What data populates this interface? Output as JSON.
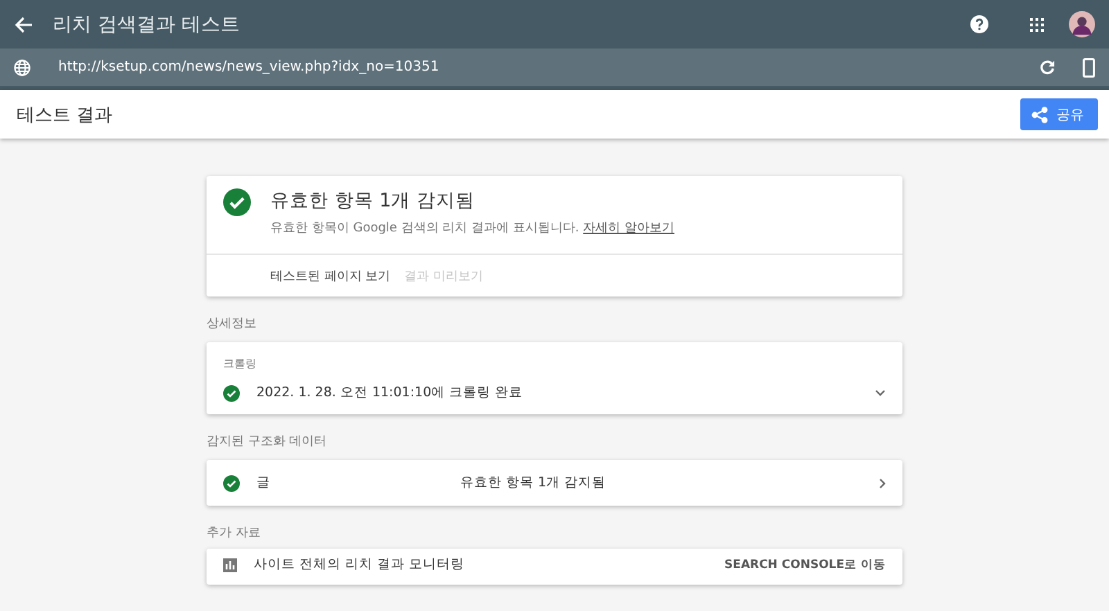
{
  "top_bar": {
    "title": "리치 검색결과 테스트"
  },
  "url_bar": {
    "url": "http://ksetup.com/news/news_view.php?idx_no=10351"
  },
  "header": {
    "title": "테스트 결과",
    "share_button": "공유"
  },
  "summary": {
    "title": "유효한 항목 1개 감지됨",
    "description": "유효한 항목이 Google 검색의 리치 결과에 표시됩니다.",
    "link": "자세히 알아보기",
    "tabs": [
      {
        "label": "테스트된 페이지 보기",
        "disabled": false
      },
      {
        "label": "결과 미리보기",
        "disabled": true
      }
    ]
  },
  "details": {
    "heading": "상세정보",
    "label": "크롤링",
    "status": "2022. 1. 28. 오전 11:01:10에 크롤링 완료"
  },
  "structured_data": {
    "heading": "감지된 구조화 데이터",
    "type": "글",
    "result": "유효한 항목 1개 감지됨"
  },
  "resources": {
    "heading": "추가 자료",
    "item": "사이트 전체의 리치 결과 모니터링",
    "action": "SEARCH CONSOLE로 이동"
  }
}
